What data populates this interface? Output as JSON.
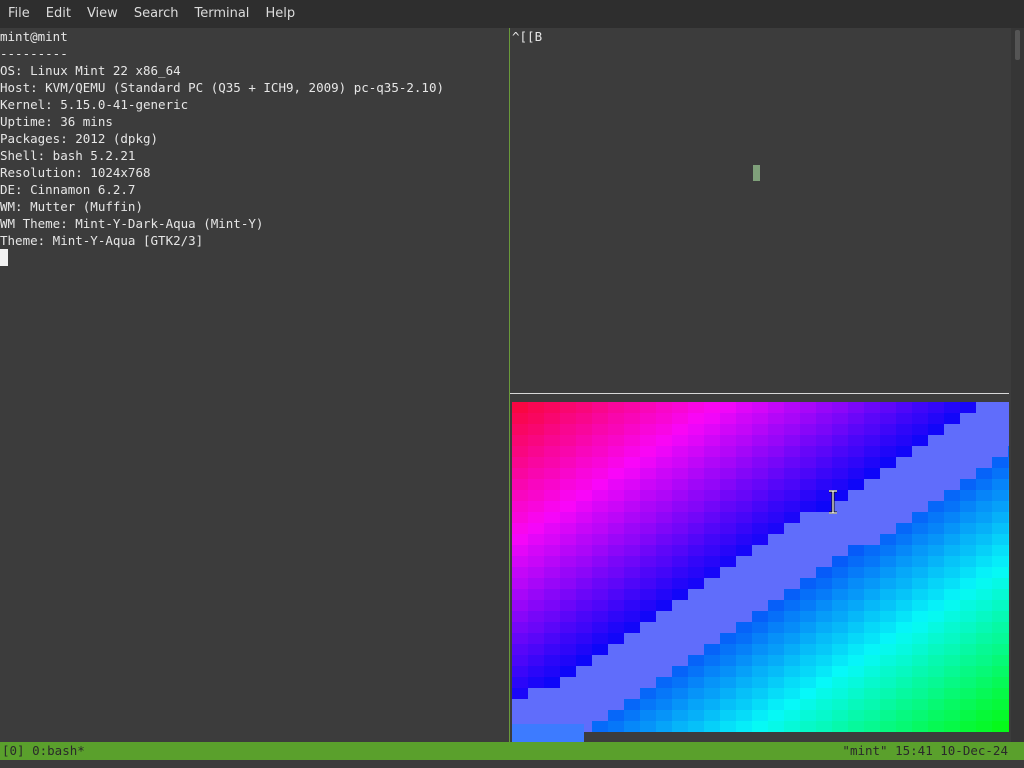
{
  "menu": {
    "file": "File",
    "edit": "Edit",
    "view": "View",
    "search": "Search",
    "terminal": "Terminal",
    "help": "Help"
  },
  "left_pane": {
    "lines": [
      "mint@mint",
      "---------",
      "OS: Linux Mint 22 x86_64",
      "Host: KVM/QEMU (Standard PC (Q35 + ICH9, 2009) pc-q35-2.10)",
      "Kernel: 5.15.0-41-generic",
      "Uptime: 36 mins",
      "Packages: 2012 (dpkg)",
      "Shell: bash 5.2.21",
      "Resolution: 1024x768",
      "DE: Cinnamon 6.2.7",
      "WM: Mutter (Muffin)",
      "WM Theme: Mint-Y-Dark-Aqua (Mint-Y)",
      "Theme: Mint-Y-Aqua [GTK2/3]"
    ]
  },
  "right_top_pane": {
    "text": "^[[B"
  },
  "status": {
    "left": "[0] 0:bash*",
    "right": "\"mint\" 15:41 10-Dec-24"
  },
  "colors": {
    "background": "#3c3c3c",
    "menubar": "#2e2e2e",
    "status_bar": "#5aa02c",
    "vertical_divider": "#6a9a3a"
  }
}
